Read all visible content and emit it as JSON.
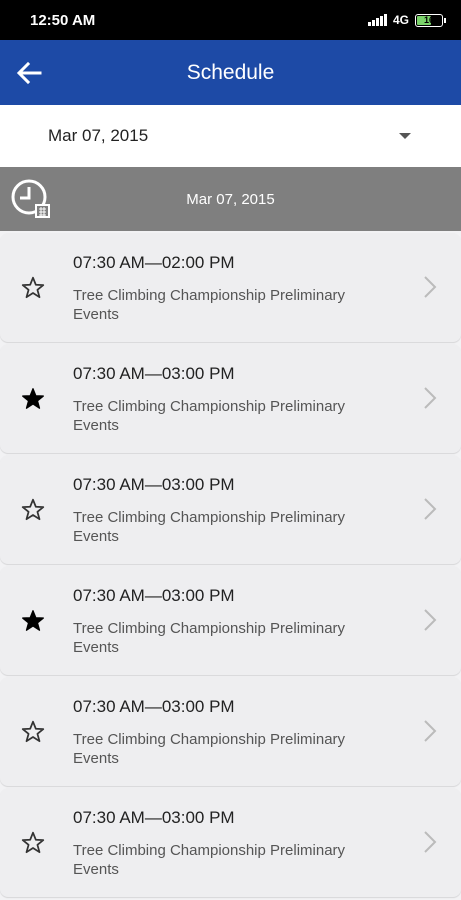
{
  "status": {
    "time": "12:50 AM",
    "network": "4G",
    "battery": "16"
  },
  "header": {
    "title": "Schedule",
    "back_icon": "back-arrow-icon"
  },
  "date_picker": {
    "value": "Mar 07, 2015"
  },
  "section": {
    "date": "Mar 07, 2015",
    "icon": "clock-calendar-icon"
  },
  "events": [
    {
      "time": "07:30 AM—02:00 PM",
      "title": "Tree Climbing Championship Preliminary Events",
      "favorite": false
    },
    {
      "time": "07:30 AM—03:00 PM",
      "title": "Tree Climbing Championship Preliminary Events",
      "favorite": true
    },
    {
      "time": "07:30 AM—03:00 PM",
      "title": "Tree Climbing Championship Preliminary Events",
      "favorite": false
    },
    {
      "time": "07:30 AM—03:00 PM",
      "title": "Tree Climbing Championship Preliminary Events",
      "favorite": true
    },
    {
      "time": "07:30 AM—03:00 PM",
      "title": "Tree Climbing Championship Preliminary Events",
      "favorite": false
    },
    {
      "time": "07:30 AM—03:00 PM",
      "title": "Tree Climbing Championship Preliminary Events",
      "favorite": false
    }
  ],
  "colors": {
    "app_bar": "#1d4aa6",
    "section_header": "#7f7f7f",
    "card": "#eeeef0"
  }
}
